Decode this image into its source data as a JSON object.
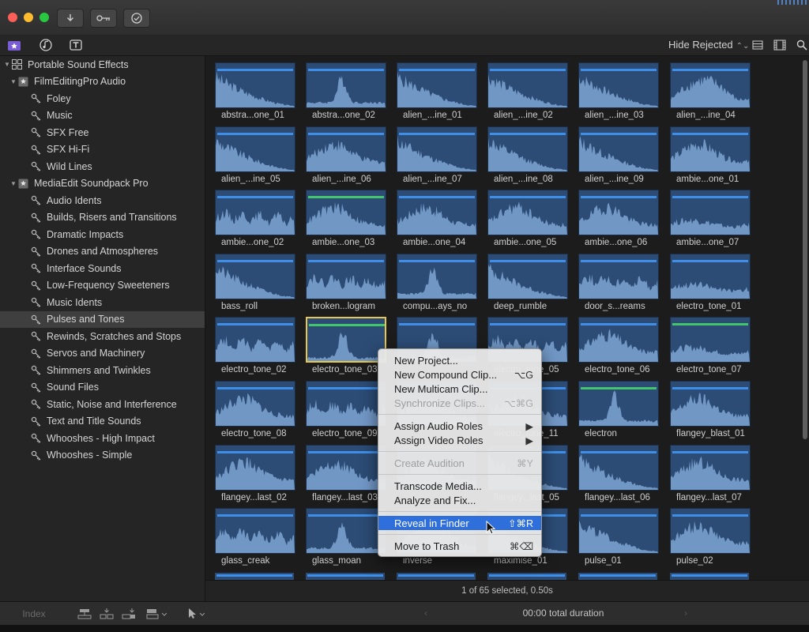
{
  "toolbar": {
    "import_icon": "download-arrow-icon",
    "keywords_icon": "key-icon",
    "background_tasks_icon": "checkmark-circle-icon"
  },
  "library_bar": {
    "filter_label": "Hide Rejected"
  },
  "sidebar": {
    "rows": [
      {
        "label": "Portable Sound Effects",
        "type": "library",
        "expanded": true
      },
      {
        "label": "FilmEditingPro Audio",
        "type": "event",
        "expanded": true
      },
      {
        "label": "Foley",
        "type": "keyword"
      },
      {
        "label": "Music",
        "type": "keyword"
      },
      {
        "label": "SFX Free",
        "type": "keyword"
      },
      {
        "label": "SFX Hi-Fi",
        "type": "keyword"
      },
      {
        "label": "Wild Lines",
        "type": "keyword"
      },
      {
        "label": "MediaEdit Soundpack Pro",
        "type": "event",
        "expanded": true
      },
      {
        "label": "Audio Idents",
        "type": "keyword"
      },
      {
        "label": "Builds, Risers and Transitions",
        "type": "keyword"
      },
      {
        "label": "Dramatic Impacts",
        "type": "keyword"
      },
      {
        "label": "Drones and Atmospheres",
        "type": "keyword"
      },
      {
        "label": "Interface Sounds",
        "type": "keyword"
      },
      {
        "label": "Low-Frequency Sweeteners",
        "type": "keyword"
      },
      {
        "label": "Music Idents",
        "type": "keyword"
      },
      {
        "label": "Pulses and Tones",
        "type": "keyword",
        "selected": true
      },
      {
        "label": "Rewinds, Scratches and Stops",
        "type": "keyword"
      },
      {
        "label": "Servos and Machinery",
        "type": "keyword"
      },
      {
        "label": "Shimmers and Twinkles",
        "type": "keyword"
      },
      {
        "label": "Sound Files",
        "type": "keyword"
      },
      {
        "label": "Static, Noise and Interference",
        "type": "keyword"
      },
      {
        "label": "Text and Title Sounds",
        "type": "keyword"
      },
      {
        "label": "Whooshes - High Impact",
        "type": "keyword"
      },
      {
        "label": "Whooshes - Simple",
        "type": "keyword"
      }
    ]
  },
  "clips": [
    {
      "label": "abstra...one_01",
      "shape": "decay"
    },
    {
      "label": "abstra...one_02",
      "shape": "spike"
    },
    {
      "label": "alien_...ine_01",
      "shape": "decay"
    },
    {
      "label": "alien_...ine_02",
      "shape": "decay"
    },
    {
      "label": "alien_...ine_03",
      "shape": "decay"
    },
    {
      "label": "alien_...ine_04",
      "shape": "swell"
    },
    {
      "label": "alien_...ine_05",
      "shape": "decay"
    },
    {
      "label": "alien_...ine_06",
      "shape": "hill"
    },
    {
      "label": "alien_...ine_07",
      "shape": "decay"
    },
    {
      "label": "alien_...ine_08",
      "shape": "decay"
    },
    {
      "label": "alien_...ine_09",
      "shape": "decay"
    },
    {
      "label": "ambie...one_01",
      "shape": "hill"
    },
    {
      "label": "ambie...one_02",
      "shape": "ripple"
    },
    {
      "label": "ambie...one_03",
      "shape": "hill",
      "green": true
    },
    {
      "label": "ambie...one_04",
      "shape": "hill"
    },
    {
      "label": "ambie...one_05",
      "shape": "hill"
    },
    {
      "label": "ambie...one_06",
      "shape": "hill"
    },
    {
      "label": "ambie...one_07",
      "shape": "flat"
    },
    {
      "label": "bass_roll",
      "shape": "decay"
    },
    {
      "label": "broken...logram",
      "shape": "ripple"
    },
    {
      "label": "compu...ays_no",
      "shape": "spike"
    },
    {
      "label": "deep_rumble",
      "shape": "decay"
    },
    {
      "label": "door_s...reams",
      "shape": "ripple"
    },
    {
      "label": "electro_tone_01",
      "shape": "flat"
    },
    {
      "label": "electro_tone_02",
      "shape": "ripple"
    },
    {
      "label": "electro_tone_03",
      "shape": "spike",
      "selected": true,
      "green": true
    },
    {
      "label": "",
      "shape": "spike"
    },
    {
      "label": "electro_tone_05",
      "shape": "ripple"
    },
    {
      "label": "electro_tone_06",
      "shape": "hill"
    },
    {
      "label": "electro_tone_07",
      "shape": "flat",
      "green": true
    },
    {
      "label": "electro_tone_08",
      "shape": "hill"
    },
    {
      "label": "electro_tone_09",
      "shape": "ripple"
    },
    {
      "label": "",
      "shape": "hill"
    },
    {
      "label": "electro_tone_11",
      "shape": "hill"
    },
    {
      "label": "electron",
      "shape": "spike",
      "green": true
    },
    {
      "label": "flangey_blast_01",
      "shape": "hill"
    },
    {
      "label": "flangey...last_02",
      "shape": "hill"
    },
    {
      "label": "flangey...last_03",
      "shape": "hill"
    },
    {
      "label": "",
      "shape": "hill"
    },
    {
      "label": "flangey...last_05",
      "shape": "decay"
    },
    {
      "label": "flangey...last_06",
      "shape": "decay"
    },
    {
      "label": "flangey...last_07",
      "shape": "hill"
    },
    {
      "label": "glass_creak",
      "shape": "ripple"
    },
    {
      "label": "glass_moan",
      "shape": "spike"
    },
    {
      "label": "inverse",
      "shape": "swell"
    },
    {
      "label": "maximise_01",
      "shape": "decay"
    },
    {
      "label": "pulse_01",
      "shape": "decay"
    },
    {
      "label": "pulse_02",
      "shape": "hill"
    }
  ],
  "context_menu": {
    "items": [
      {
        "label": "New Project...",
        "shortcut": ""
      },
      {
        "label": "New Compound Clip...",
        "shortcut": "⌥G"
      },
      {
        "label": "New Multicam Clip...",
        "shortcut": ""
      },
      {
        "label": "Synchronize Clips...",
        "shortcut": "⌥⌘G",
        "disabled": true
      },
      {
        "sep": true
      },
      {
        "label": "Assign Audio Roles",
        "shortcut": "▶"
      },
      {
        "label": "Assign Video Roles",
        "shortcut": "▶"
      },
      {
        "sep": true
      },
      {
        "label": "Create Audition",
        "shortcut": "⌘Y",
        "disabled": true
      },
      {
        "sep": true
      },
      {
        "label": "Transcode Media...",
        "shortcut": ""
      },
      {
        "label": "Analyze and Fix...",
        "shortcut": ""
      },
      {
        "sep": true
      },
      {
        "label": "Reveal in Finder",
        "shortcut": "⇧⌘R",
        "highlighted": true
      },
      {
        "sep": true
      },
      {
        "label": "Move to Trash",
        "shortcut": "⌘⌫"
      }
    ]
  },
  "status": {
    "selection": "1 of 65 selected, 0.50s"
  },
  "bottom": {
    "index_label": "Index",
    "duration": "00:00 total duration"
  },
  "colors": {
    "waveform_bg": "#2c4c75",
    "waveform_fill": "#7ea4d4",
    "audio_bar": "#3f8fe8",
    "favorite_bar": "#43c56b",
    "selection_outline": "#e8c84a",
    "menu_highlight": "#2f6fdb"
  }
}
